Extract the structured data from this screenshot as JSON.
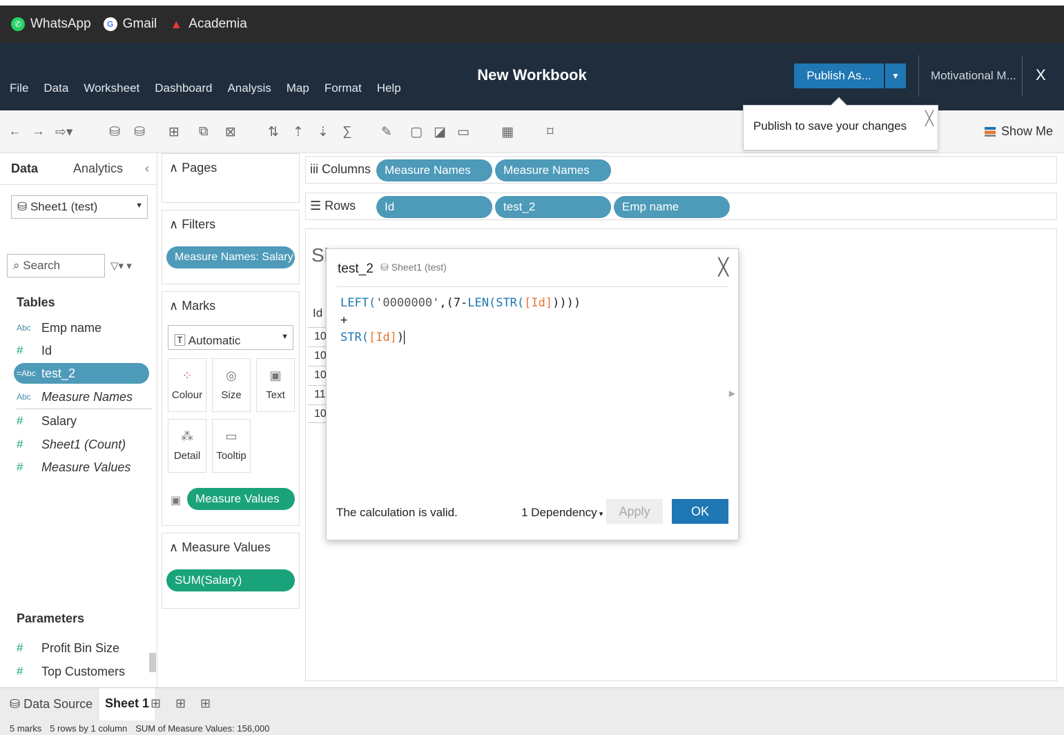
{
  "bookmarks": [
    {
      "label": "WhatsApp",
      "icon": "whatsapp-icon",
      "color": "#25D366"
    },
    {
      "label": "Gmail",
      "icon": "google-icon",
      "color": "#4285F4"
    },
    {
      "label": "Academia",
      "icon": "academia-icon",
      "color": "#e53935"
    }
  ],
  "app": {
    "menu": [
      "File",
      "Data",
      "Worksheet",
      "Dashboard",
      "Analysis",
      "Map",
      "Format",
      "Help"
    ],
    "title": "New Workbook",
    "publish_label": "Publish As...",
    "account_label": "Motivational M...",
    "close_label": "X",
    "publish_tip": "Publish to save your changes",
    "show_me": "Show Me"
  },
  "data_pane": {
    "tab_data": "Data",
    "tab_analytics": "Analytics",
    "datasource": "Sheet1 (test)",
    "search_placeholder": "Search",
    "tables_title": "Tables",
    "fields": [
      {
        "type": "Abc",
        "name": "Emp name"
      },
      {
        "type": "#",
        "name": "Id"
      },
      {
        "type": "=Abc",
        "name": "test_2"
      },
      {
        "type": "Abc",
        "name": "Measure Names"
      },
      {
        "type": "#",
        "name": "Salary"
      },
      {
        "type": "#",
        "name": "Sheet1 (Count)"
      },
      {
        "type": "#",
        "name": "Measure Values"
      }
    ],
    "parameters_title": "Parameters",
    "parameters": [
      {
        "type": "#",
        "name": "Profit Bin Size"
      },
      {
        "type": "#",
        "name": "Top Customers"
      }
    ]
  },
  "cards": {
    "pages": "Pages",
    "filters": "Filters",
    "filter_pill": "Measure Names: Salary",
    "marks": "Marks",
    "mark_type": "Automatic",
    "mark_buttons": [
      "Colour",
      "Size",
      "Text",
      "Detail",
      "Tooltip"
    ],
    "marks_pill": "Measure Values",
    "measure_values": "Measure Values",
    "mv_pill": "SUM(Salary)"
  },
  "shelves": {
    "columns_label": "Columns",
    "columns": [
      "Measure Names",
      "Measure Names"
    ],
    "rows_label": "Rows",
    "rows": [
      "Id",
      "test_2",
      "Emp name"
    ]
  },
  "canvas": {
    "sheet_title": "Sh",
    "col_header": "Id",
    "cells": [
      "10",
      "10",
      "10",
      "11",
      "10"
    ]
  },
  "calc_dialog": {
    "name": "test_2",
    "source": "Sheet1 (test)",
    "line1_fn": "LEFT(",
    "line1_str": "'0000000'",
    "line1_mid": ",(7-",
    "line1_fn2": "LEN(STR(",
    "line1_ref": "[Id]",
    "line1_end": "))))",
    "line2": "+",
    "line3_fn": "STR(",
    "line3_ref": "[Id]",
    "line3_end": ")",
    "status": "The calculation is valid.",
    "dependency": "1 Dependency",
    "apply": "Apply",
    "ok": "OK"
  },
  "bottom": {
    "datasource_tab": "Data Source",
    "sheet_tab": "Sheet 1"
  },
  "status": {
    "marks": "5 marks",
    "rows": "5 rows by 1 column",
    "sum": "SUM of Measure Values: 156,000"
  }
}
